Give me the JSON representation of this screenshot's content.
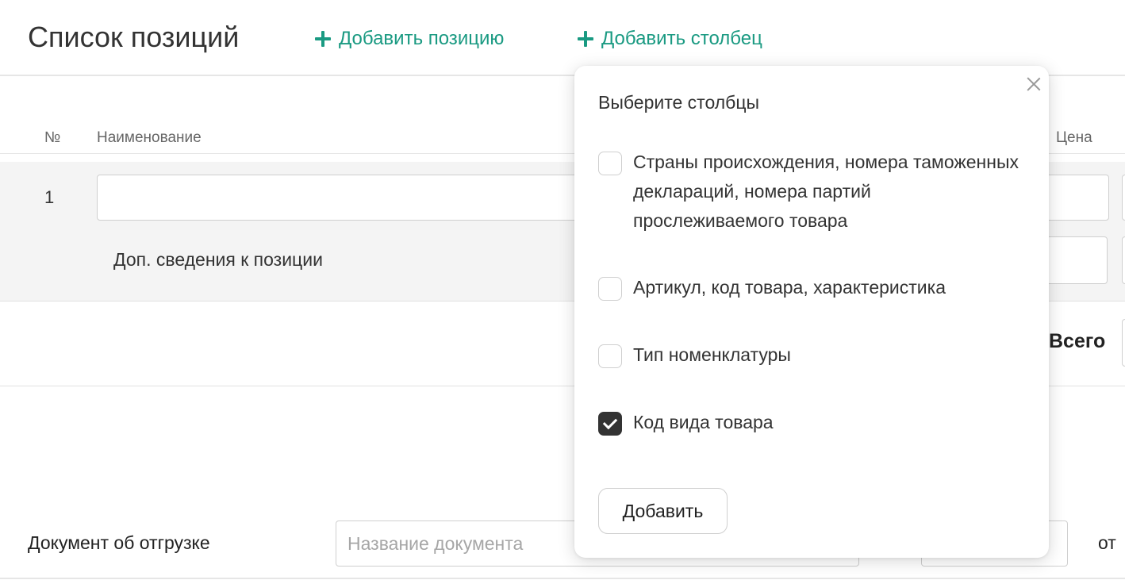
{
  "header": {
    "title": "Список позиций",
    "add_position_label": "Добавить позицию",
    "add_column_label": "Добавить столбец"
  },
  "table": {
    "columns": {
      "number": "№",
      "name": "Наименование",
      "price": "Цена"
    },
    "rows": [
      {
        "number": "1",
        "name_value": "",
        "extra_info_label": "Доп. сведения к позиции"
      }
    ],
    "total_label": "Всего"
  },
  "shipment": {
    "label": "Документ об отгрузке",
    "doc_name_placeholder": "Название документа",
    "date_value": "",
    "from_label": "от"
  },
  "column_picker": {
    "title": "Выберите столбцы",
    "options": [
      {
        "label": "Страны происхождения, номера таможенных деклараций, номера партий прослеживаемого товара",
        "checked": false
      },
      {
        "label": "Артикул, код товара, характеристика",
        "checked": false
      },
      {
        "label": "Тип номенклатуры",
        "checked": false
      },
      {
        "label": "Код вида товара",
        "checked": true
      }
    ],
    "add_button_label": "Добавить"
  },
  "colors": {
    "accent": "#1a9a82",
    "text": "#222222",
    "checked_fill": "#333333",
    "row_background": "#f4f4f4"
  },
  "icons": {
    "add": "plus-icon",
    "close": "close-icon",
    "check": "check-icon"
  }
}
